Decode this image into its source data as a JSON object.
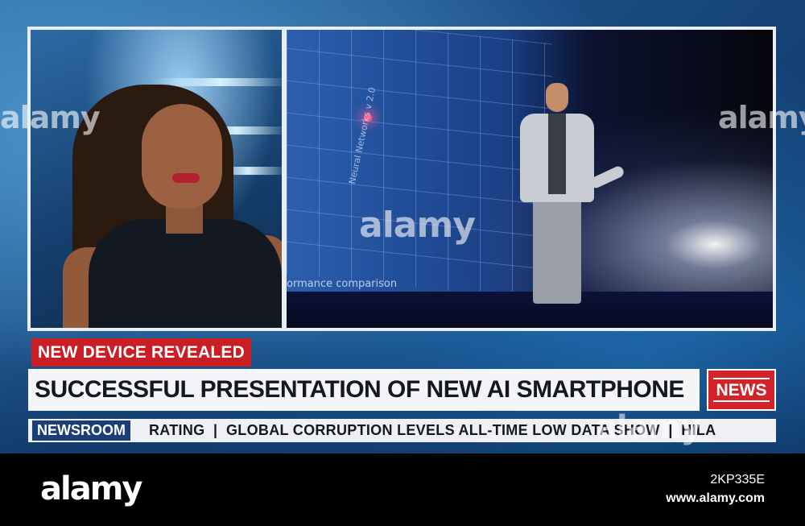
{
  "panels": {
    "screen_label": "Neural Networks v 2.0",
    "screen_caption": "ormance comparison"
  },
  "lower_third": {
    "tag": "NEW DEVICE REVEALED",
    "headline": "SUCCESSFUL PRESENTATION OF NEW AI SMARTPHONE",
    "badge": "NEWS",
    "ticker_label": "NEWSROOM",
    "ticker_text": "RATING  |  GLOBAL CORRUPTION LEVELS ALL-TIME LOW DATA SHOW  |  HILA"
  },
  "watermarks": {
    "left": "alamy",
    "center": "alamy",
    "right": "alamy",
    "ticker": "alamy"
  },
  "footer": {
    "logo": "alamy",
    "image_id": "2KP335E",
    "url": "www.alamy.com"
  },
  "colors": {
    "tag_red": "#c81e24",
    "badge_red": "#d2232a",
    "ticker_label_blue": "#1d3d78",
    "footer_black": "#000000"
  }
}
